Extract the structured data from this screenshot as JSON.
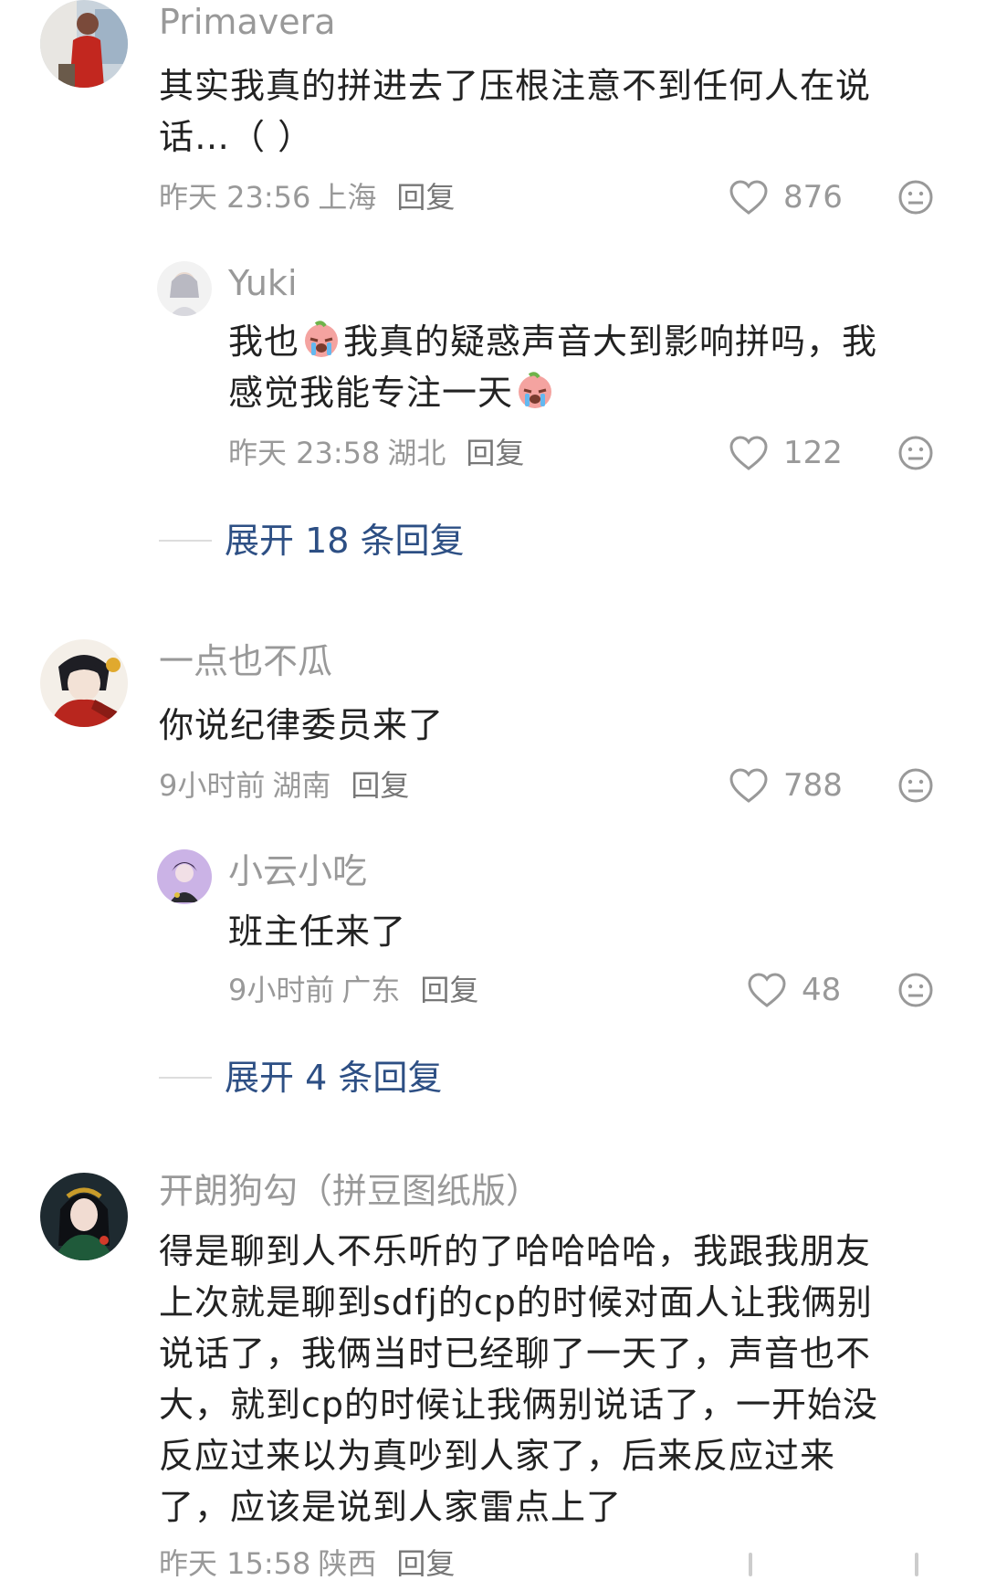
{
  "comments": [
    {
      "username": "Primavera",
      "lines": [
        "其实我真的拼进去了压根注意不到任何人在说",
        "话…（ ）"
      ],
      "time": "昨天 23:56",
      "location": "上海",
      "reply_label": "回复",
      "likes": "876"
    },
    {
      "username": "Yuki",
      "line1_a": "我也",
      "line1_b": "我真的疑惑声音大到影响拼吗，我",
      "line2_a": "感觉我能专注一天",
      "time": "昨天 23:58",
      "location": "湖北",
      "reply_label": "回复",
      "likes": "122"
    },
    {
      "username": "一点也不瓜",
      "lines": [
        "你说纪律委员来了"
      ],
      "time": "9小时前",
      "location": "湖南",
      "reply_label": "回复",
      "likes": "788"
    },
    {
      "username": "小云小吃",
      "lines": [
        "班主任来了"
      ],
      "time": "9小时前",
      "location": "广东",
      "reply_label": "回复",
      "likes": "48"
    },
    {
      "username": "开朗狗勾（拼豆图纸版）",
      "lines": [
        "得是聊到人不乐听的了哈哈哈哈，我跟我朋友",
        "上次就是聊到sdfj的cp的时候对面人让我俩别",
        "说话了，我俩当时已经聊了一天了，声音也不",
        "大，就到cp的时候让我俩别说话了，一开始没",
        "反应过来以为真吵到人家了，后来反应过来",
        "了，应该是说到人家雷点上了"
      ],
      "time": "昨天 15:58",
      "location": "陕西",
      "reply_label": "回复"
    }
  ],
  "expand_1": "展开 18 条回复",
  "expand_2": "展开 4 条回复",
  "icons": {
    "like": "heart-outline-icon",
    "dislike": "neutral-face-icon",
    "emoji": "crying-emoji"
  },
  "colors": {
    "meta": "#999999",
    "text": "#222222",
    "expand": "#2d4f84"
  }
}
